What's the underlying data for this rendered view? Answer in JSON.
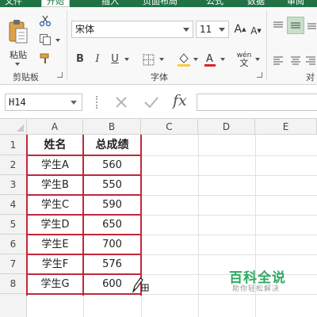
{
  "ribbon": {
    "tabs": [
      "文件",
      "开始",
      "插入",
      "页面布局",
      "公式",
      "数据",
      "审阅"
    ],
    "active_tab": "开始",
    "clipboard_group": "剪贴板",
    "paste_label": "粘贴",
    "font_group": "字体",
    "alignment_group_partial": "对",
    "font_name": "宋体",
    "font_size": "11",
    "bold": "B",
    "italic": "I",
    "underline": "U",
    "phonetic": "wén"
  },
  "formula_bar": {
    "name_box": "H14",
    "fx": "fx",
    "formula": ""
  },
  "sheet": {
    "columns": [
      "A",
      "B",
      "C",
      "D",
      "E"
    ],
    "rows": [
      "1",
      "2",
      "3",
      "4",
      "5",
      "6",
      "7",
      "8"
    ],
    "headers": [
      "姓名",
      "总成绩"
    ],
    "data": [
      [
        "学生A",
        "560"
      ],
      [
        "学生B",
        "550"
      ],
      [
        "学生C",
        "590"
      ],
      [
        "学生D",
        "650"
      ],
      [
        "学生E",
        "700"
      ],
      [
        "学生F",
        "576"
      ],
      [
        "学生G",
        "600"
      ]
    ]
  },
  "watermark": {
    "title": "百科全说",
    "subtitle": "助你轻松解决"
  }
}
